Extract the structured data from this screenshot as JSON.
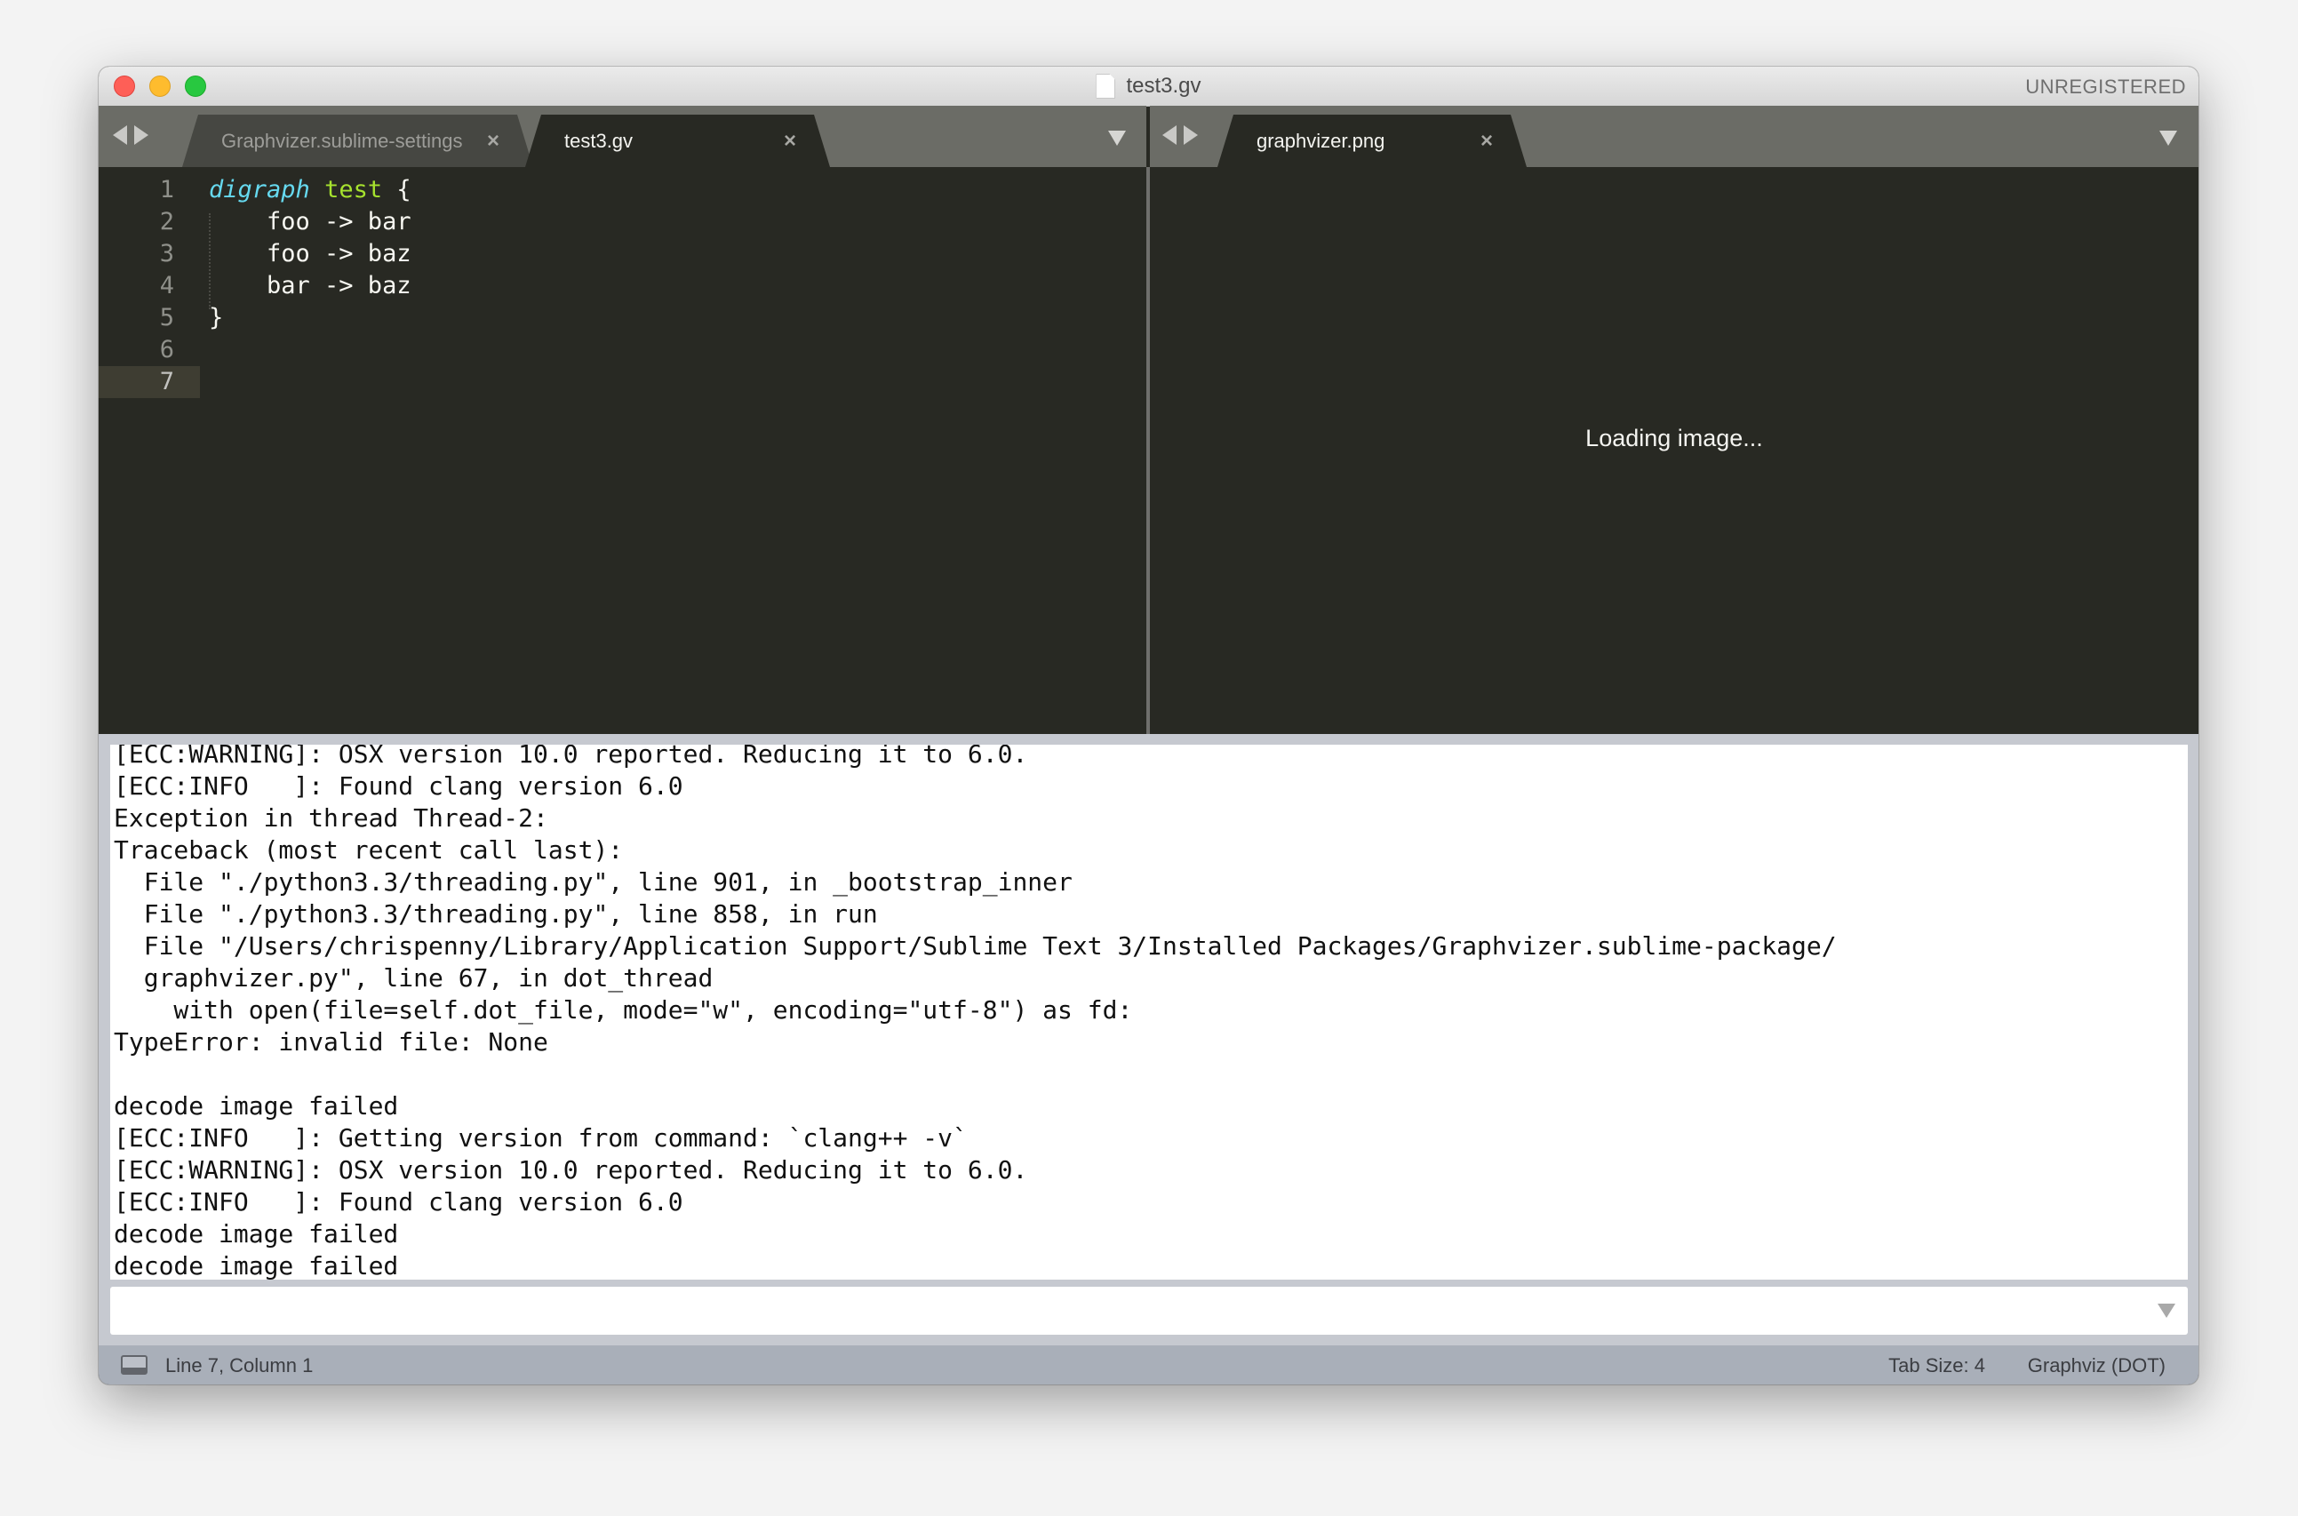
{
  "window": {
    "title": "test3.gv",
    "registration": "UNREGISTERED",
    "traffic_lights": [
      "close",
      "minimize",
      "zoom"
    ]
  },
  "left_group": {
    "tabs": [
      {
        "label": "Graphvizer.sublime-settings",
        "active": false,
        "close": "×"
      },
      {
        "label": "test3.gv",
        "active": true,
        "close": "×"
      }
    ]
  },
  "right_group": {
    "tabs": [
      {
        "label": "graphvizer.png",
        "active": true,
        "close": "×"
      }
    ],
    "status_message": "Loading image..."
  },
  "editor": {
    "line_numbers": [
      "1",
      "2",
      "3",
      "4",
      "5",
      "6",
      "7"
    ],
    "current_line": 7,
    "lines": [
      {
        "keyword": "digraph",
        "name": "test",
        "rest": " {"
      },
      {
        "text": "    foo -> bar"
      },
      {
        "text": "    foo -> baz"
      },
      {
        "text": "    bar -> baz"
      },
      {
        "text": "}"
      },
      {
        "text": ""
      },
      {
        "text": ""
      }
    ],
    "syntax_colors": {
      "keyword": "#66d9ef",
      "entity": "#a6e22e",
      "text": "#f8f8f2",
      "background": "#282923"
    }
  },
  "console": {
    "lines": [
      "[ECC:WARNING]: OSX version 10.0 reported. Reducing it to 6.0.",
      "[ECC:INFO   ]: Found clang version 6.0",
      "Exception in thread Thread-2:",
      "Traceback (most recent call last):",
      "  File \"./python3.3/threading.py\", line 901, in _bootstrap_inner",
      "  File \"./python3.3/threading.py\", line 858, in run",
      "  File \"/Users/chrispenny/Library/Application Support/Sublime Text 3/Installed Packages/Graphvizer.sublime-package/",
      "  graphvizer.py\", line 67, in dot_thread",
      "    with open(file=self.dot_file, mode=\"w\", encoding=\"utf-8\") as fd:",
      "TypeError: invalid file: None",
      "",
      "decode image failed",
      "[ECC:INFO   ]: Getting version from command: `clang++ -v`",
      "[ECC:WARNING]: OSX version 10.0 reported. Reducing it to 6.0.",
      "[ECC:INFO   ]: Found clang version 6.0",
      "decode image failed",
      "decode image failed"
    ],
    "input_value": "",
    "input_placeholder": ""
  },
  "statusbar": {
    "position": "Line 7, Column 1",
    "tab_size": "Tab Size: 4",
    "syntax": "Graphviz (DOT)"
  }
}
